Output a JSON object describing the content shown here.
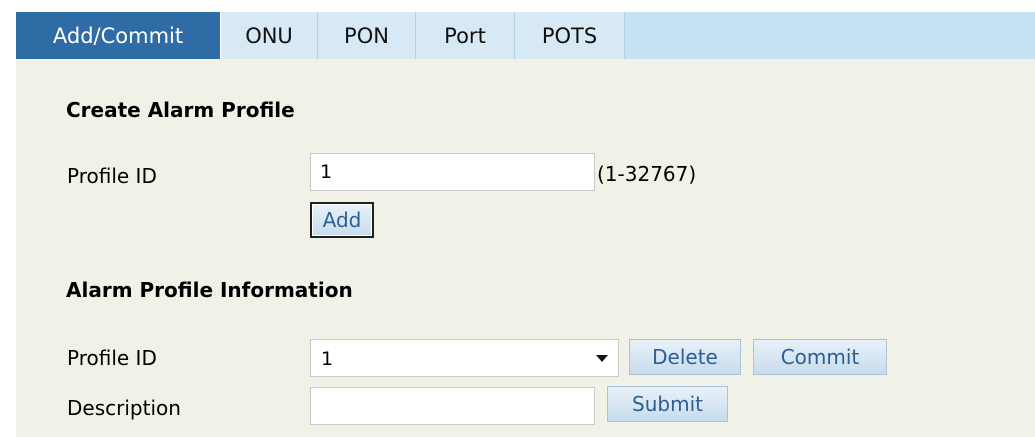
{
  "tabs": [
    {
      "label": "Add/Commit",
      "active": true
    },
    {
      "label": "ONU",
      "active": false
    },
    {
      "label": "PON",
      "active": false
    },
    {
      "label": "Port",
      "active": false
    },
    {
      "label": "POTS",
      "active": false
    }
  ],
  "create_section": {
    "title": "Create Alarm Profile",
    "profile_id_label": "Profile ID",
    "profile_id_value": "1",
    "range_hint": "(1-32767)",
    "add_label": "Add"
  },
  "info_section": {
    "title": "Alarm Profile Information",
    "profile_id_label": "Profile ID",
    "profile_id_selected": "1",
    "delete_label": "Delete",
    "commit_label": "Commit",
    "description_label": "Description",
    "description_value": "",
    "submit_label": "Submit"
  },
  "colors": {
    "tab_active_bg": "#2f6ba4",
    "tabbar_bg": "#c6e1f1",
    "panel_bg": "#f2f1e8",
    "button_text": "#2b5f95"
  }
}
